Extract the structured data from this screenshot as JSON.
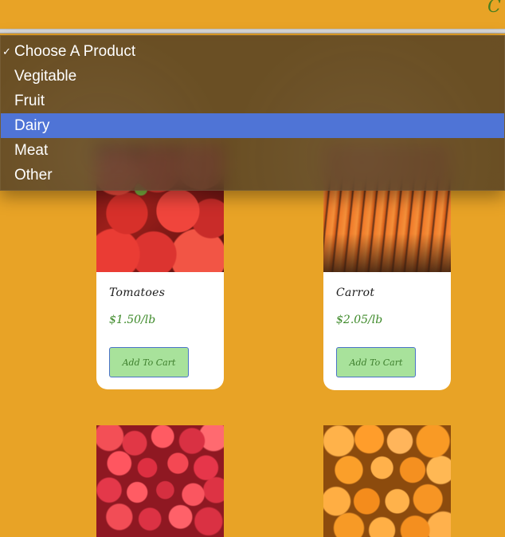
{
  "header": {
    "brand_glyph": "C"
  },
  "dropdown": {
    "options": [
      {
        "label": "Choose A Product",
        "checked": true,
        "highlighted": false
      },
      {
        "label": "Vegitable",
        "checked": false,
        "highlighted": false
      },
      {
        "label": "Fruit",
        "checked": false,
        "highlighted": false
      },
      {
        "label": "Dairy",
        "checked": false,
        "highlighted": true
      },
      {
        "label": "Meat",
        "checked": false,
        "highlighted": false
      },
      {
        "label": "Other",
        "checked": false,
        "highlighted": false
      }
    ],
    "check_glyph": "✓"
  },
  "products": [
    {
      "name": "Tomatoes",
      "price": "$1.50/lb",
      "button": "Add To Cart",
      "image": "tomatoes-photo"
    },
    {
      "name": "Carrot",
      "price": "$2.05/lb",
      "button": "Add To Cart",
      "image": "carrot-photo"
    },
    {
      "name": "",
      "price": "",
      "button": "",
      "image": "strawberries-photo"
    },
    {
      "name": "",
      "price": "",
      "button": "",
      "image": "oranges-photo"
    }
  ],
  "colors": {
    "background": "#E8A326",
    "card_background": "#ffffff",
    "price": "#3E8A2A",
    "button_background": "#A8E29B",
    "button_border": "#4A73C8",
    "menu_background": "#4A3A24",
    "menu_highlight": "#4F74D6"
  }
}
